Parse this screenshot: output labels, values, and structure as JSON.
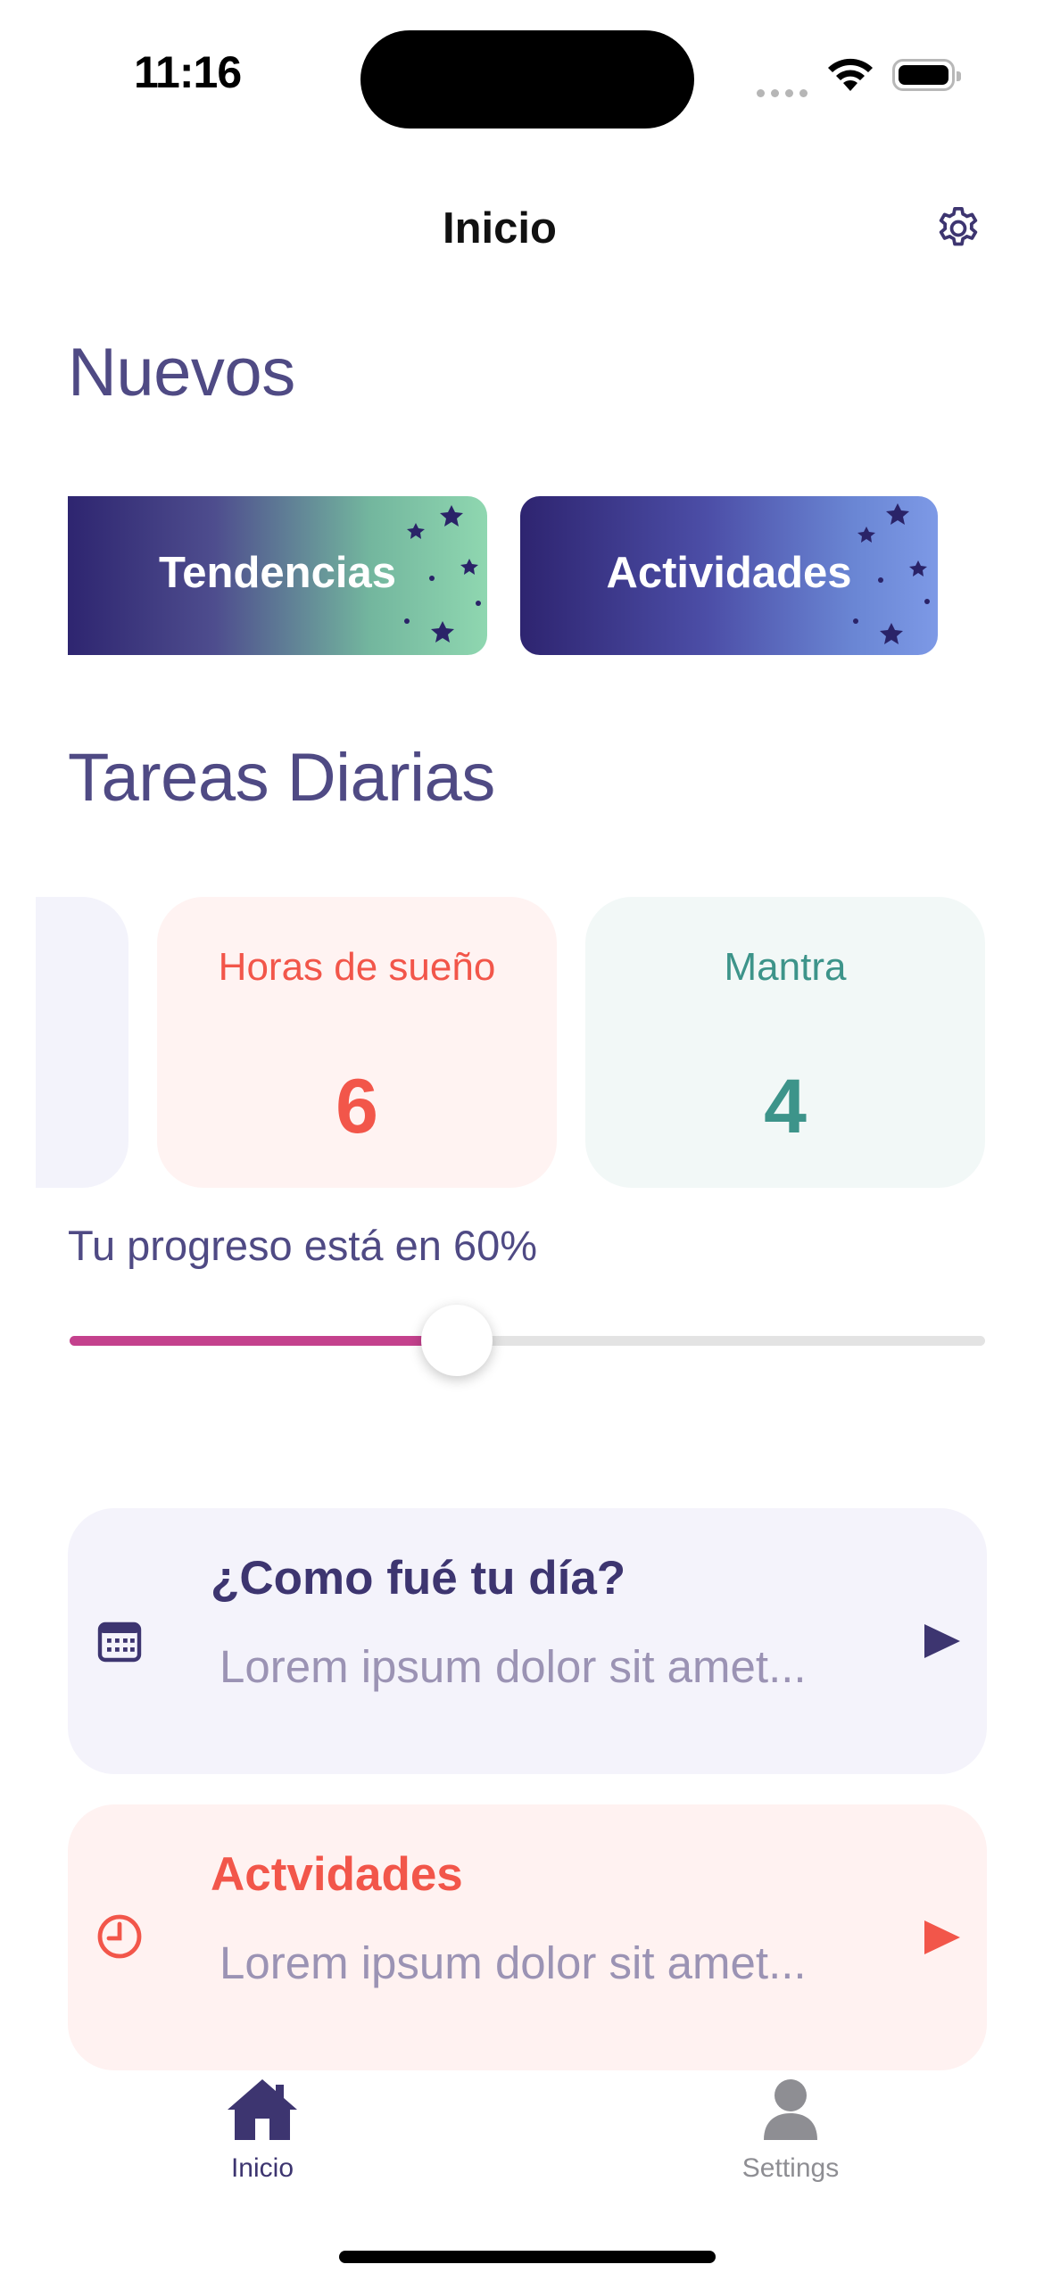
{
  "status_bar": {
    "time": "11:16"
  },
  "nav": {
    "title": "Inicio"
  },
  "sections": {
    "new_title": "Nuevos",
    "daily_title": "Tareas Diarias"
  },
  "categories": [
    {
      "label": "Tendencias"
    },
    {
      "label": "Actividades"
    }
  ],
  "tasks": [
    {
      "label": "Horas de sueño",
      "value": "6",
      "color": "#f2564a"
    },
    {
      "label": "Mantra",
      "value": "4",
      "color": "#3d948a"
    }
  ],
  "progress": {
    "text": "Tu progreso está en 60%",
    "value": 0.6
  },
  "rows": [
    {
      "title": "¿Como fué tu día?",
      "subtitle": "Lorem ipsum dolor sit amet...",
      "icon": "calendar-icon",
      "color": "#3d3570"
    },
    {
      "title": "Actvidades",
      "subtitle": "Lorem ipsum dolor sit amet...",
      "icon": "clock-icon",
      "color": "#f2564a"
    }
  ],
  "tab_bar": {
    "items": [
      {
        "label": "Inicio",
        "icon": "house-icon",
        "active": true
      },
      {
        "label": "Settings",
        "icon": "person-icon",
        "active": false
      }
    ]
  },
  "colors": {
    "accent": "#4f4a84",
    "progress": "#c4418d"
  }
}
